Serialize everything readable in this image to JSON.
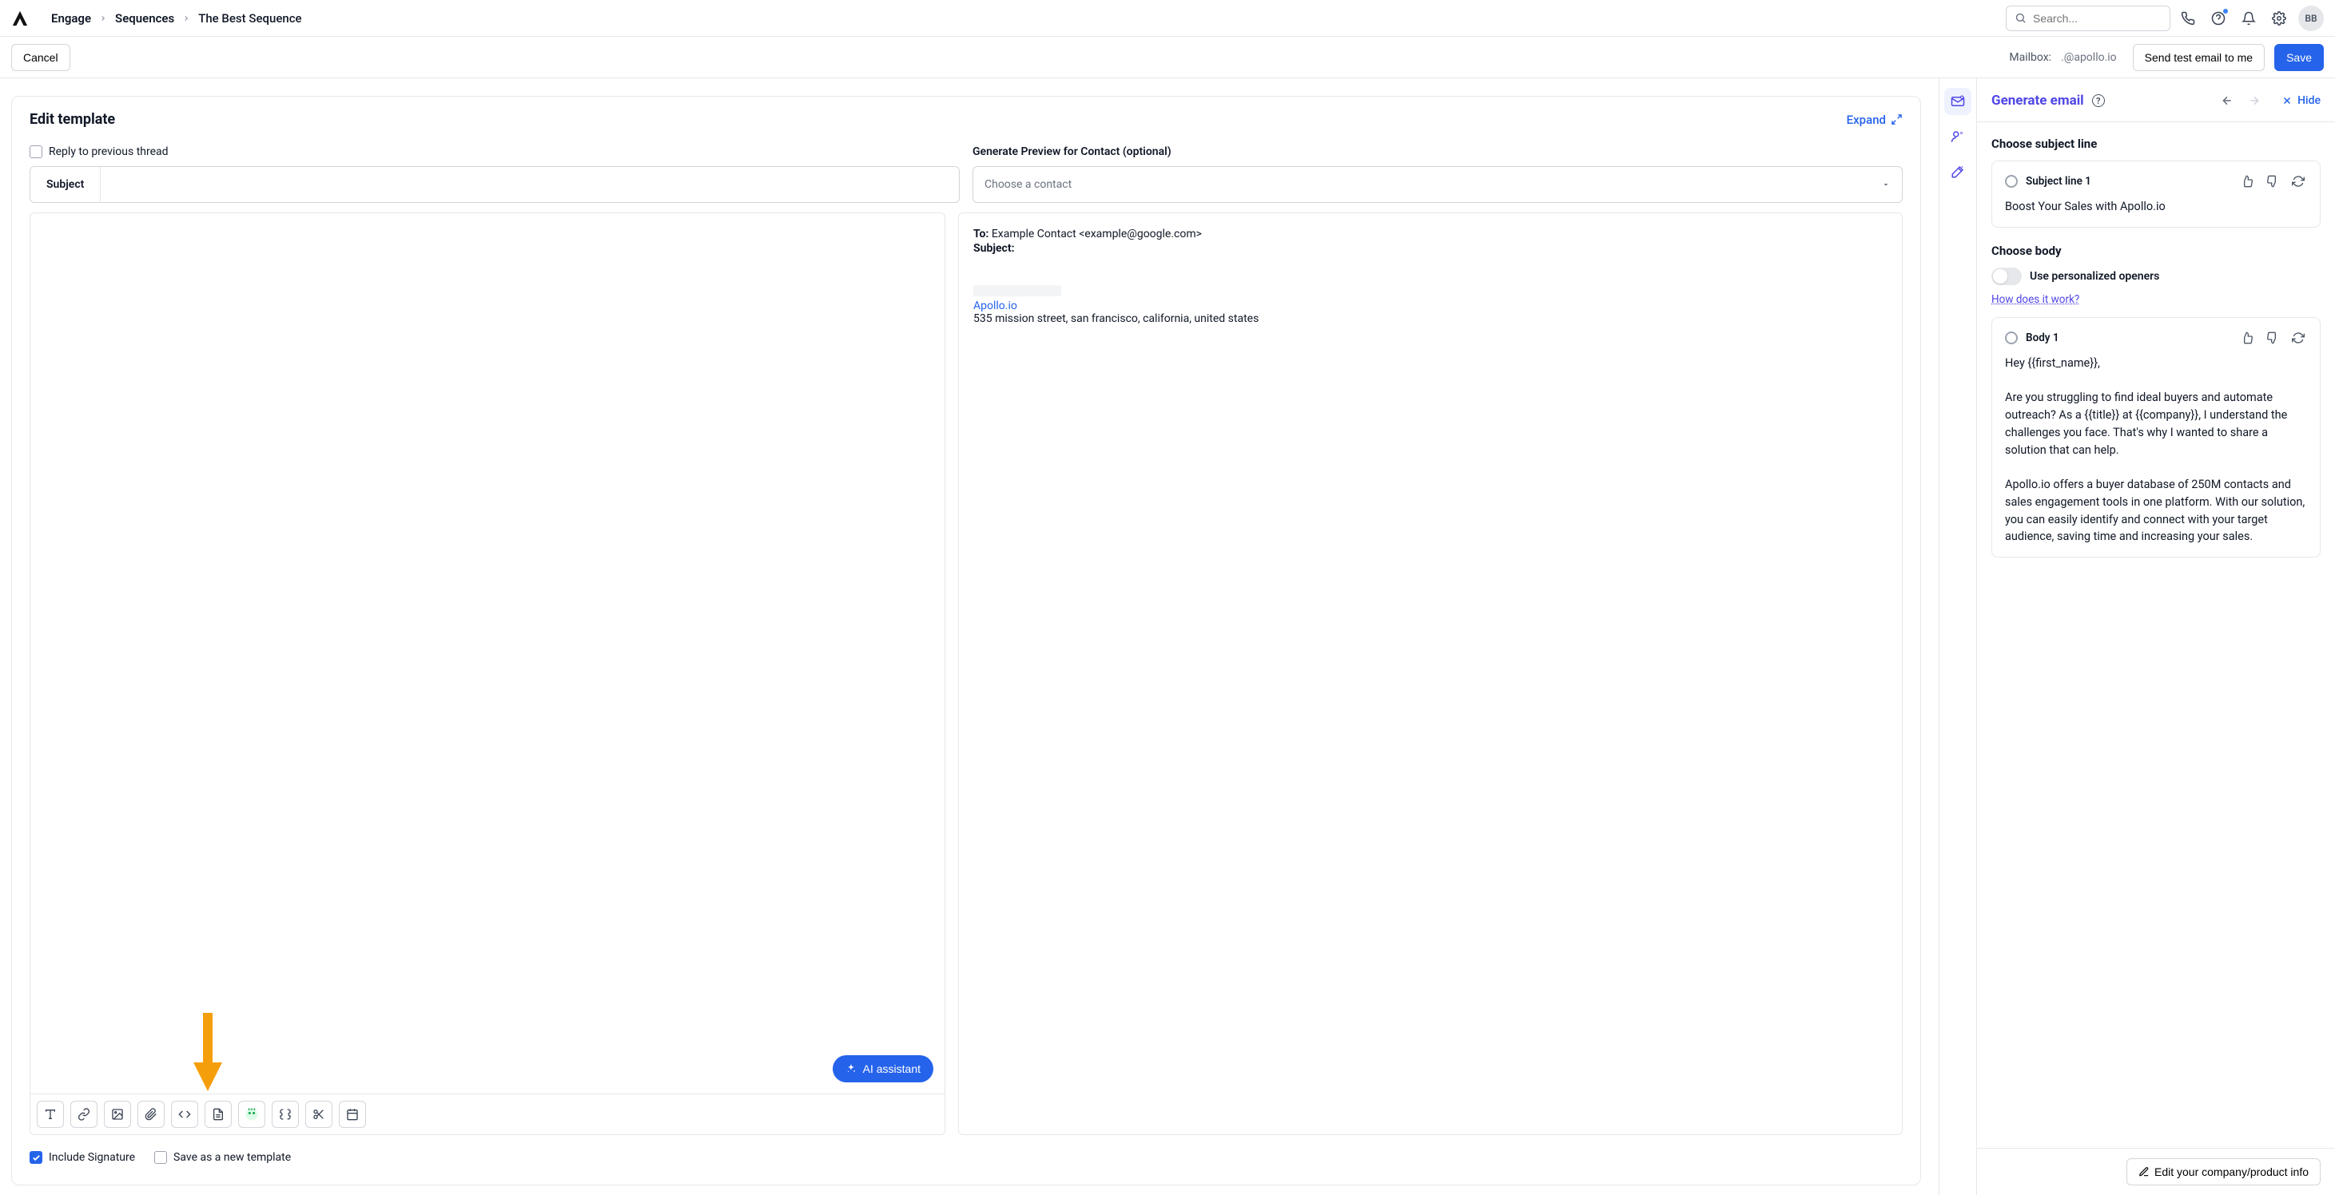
{
  "breadcrumbs": {
    "engage": "Engage",
    "sequences": "Sequences",
    "current": "The Best Sequence"
  },
  "topbar": {
    "search_placeholder": "Search...",
    "avatar": "BB"
  },
  "actionbar": {
    "cancel": "Cancel",
    "mailbox_label": "Mailbox:",
    "mailbox_value": ".@apollo.io",
    "send_test": "Send test email to me",
    "save": "Save"
  },
  "editor": {
    "title": "Edit template",
    "expand": "Expand",
    "reply_previous": "Reply to previous thread",
    "subject_label": "Subject",
    "generate_preview_label": "Generate Preview for Contact (optional)",
    "contact_placeholder": "Choose a contact",
    "ai_assistant": "AI assistant",
    "include_signature": "Include Signature",
    "save_new_template": "Save as a new template"
  },
  "preview": {
    "to_label": "To:",
    "to_value": "Example Contact <example@google.com>",
    "subject_label": "Subject:",
    "sig_link": "Apollo.io",
    "sig_address": "535 mission street, san francisco, california, united states"
  },
  "right": {
    "title": "Generate email",
    "hide": "Hide",
    "choose_subject": "Choose subject line",
    "subject1_name": "Subject line 1",
    "subject1_text": "Boost Your Sales with Apollo.io",
    "choose_body": "Choose body",
    "toggle_label": "Use personalized openers",
    "how_link": "How does it work?",
    "body1_name": "Body 1",
    "body1_text": "Hey {{first_name}},\n\nAre you struggling to find ideal buyers and automate outreach? As a {{title}} at {{company}}, I understand the challenges you face. That's why I wanted to share a solution that can help.\n\nApollo.io offers a buyer database of 250M contacts and sales engagement tools in one platform. With our solution, you can easily identify and connect with your target audience, saving time and increasing your sales.",
    "edit_company": "Edit your company/product info"
  }
}
